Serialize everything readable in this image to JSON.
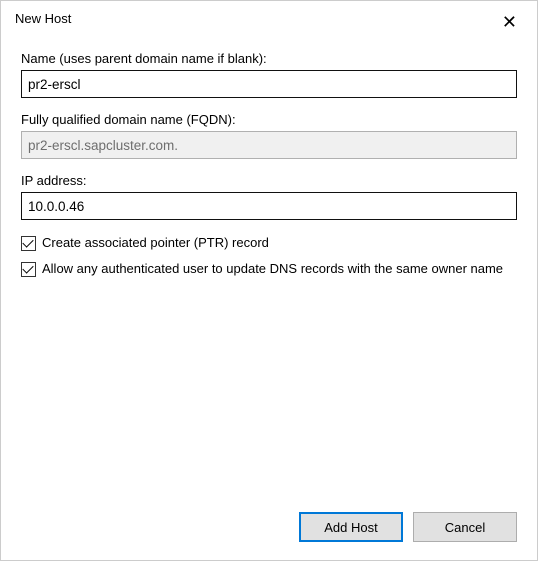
{
  "title": "New Host",
  "fields": {
    "name": {
      "label": "Name (uses parent domain name if blank):",
      "value": "pr2-erscl"
    },
    "fqdn": {
      "label": "Fully qualified domain name (FQDN):",
      "value": "pr2-erscl.sapcluster.com."
    },
    "ip": {
      "label": "IP address:",
      "value": "10.0.0.46"
    }
  },
  "checkboxes": {
    "ptr": {
      "label": "Create associated pointer (PTR) record",
      "checked": true
    },
    "allow_update": {
      "label": "Allow any authenticated user to update DNS records with the same owner name",
      "checked": true
    }
  },
  "buttons": {
    "add_host": "Add Host",
    "cancel": "Cancel"
  }
}
